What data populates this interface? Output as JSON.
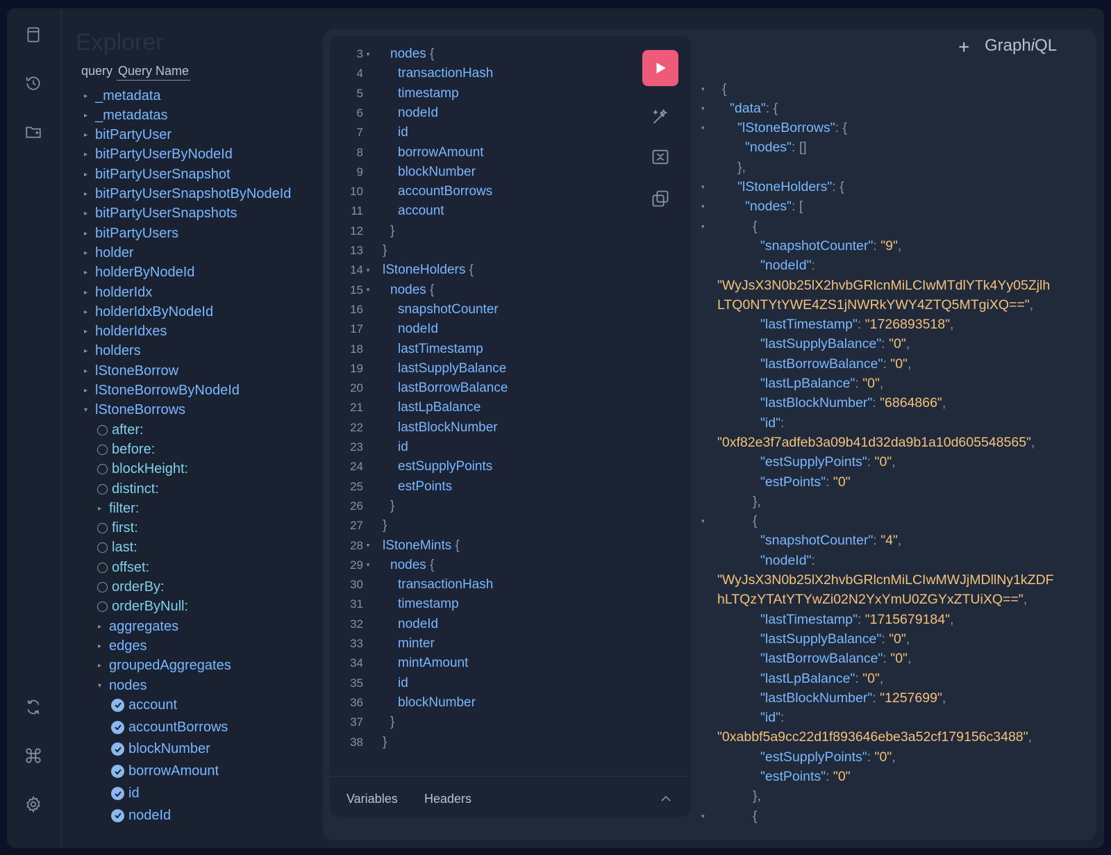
{
  "brand": {
    "text": "Graph",
    "i": "i",
    "ql": "QL"
  },
  "sidebar_icons": [
    {
      "name": "docs-icon"
    },
    {
      "name": "history-icon"
    },
    {
      "name": "explorer-icon"
    },
    {
      "name": "refetch-icon"
    },
    {
      "name": "shortcuts-icon"
    },
    {
      "name": "settings-icon"
    }
  ],
  "explorer": {
    "title": "Explorer",
    "query_keyword": "query",
    "query_name": "Query Name",
    "root_fields": [
      "_metadata",
      "_metadatas",
      "bitPartyUser",
      "bitPartyUserByNodeId",
      "bitPartyUserSnapshot",
      "bitPartyUserSnapshotByNodeId",
      "bitPartyUserSnapshots",
      "bitPartyUsers",
      "holder",
      "holderByNodeId",
      "holderIdx",
      "holderIdxByNodeId",
      "holderIdxes",
      "holders",
      "lStoneBorrow",
      "lStoneBorrowByNodeId",
      "lStoneBorrows"
    ],
    "args": [
      {
        "label": "after:",
        "type": "radio"
      },
      {
        "label": "before:",
        "type": "radio"
      },
      {
        "label": "blockHeight:",
        "type": "radio"
      },
      {
        "label": "distinct:",
        "type": "radio"
      },
      {
        "label": "filter:",
        "type": "caret"
      },
      {
        "label": "first:",
        "type": "radio"
      },
      {
        "label": "last:",
        "type": "radio"
      },
      {
        "label": "offset:",
        "type": "radio"
      },
      {
        "label": "orderBy:",
        "type": "radio"
      },
      {
        "label": "orderByNull:",
        "type": "radio"
      }
    ],
    "sub_fields": [
      "aggregates",
      "edges",
      "groupedAggregates"
    ],
    "nodes_label": "nodes",
    "checked_fields": [
      "account",
      "accountBorrows",
      "blockNumber",
      "borrowAmount",
      "id",
      "nodeId"
    ]
  },
  "editor": {
    "lines": [
      {
        "n": "3",
        "fold": true,
        "indent": 1,
        "text": "nodes",
        "brace": " {"
      },
      {
        "n": "4",
        "fold": false,
        "indent": 2,
        "text": "transactionHash",
        "brace": ""
      },
      {
        "n": "5",
        "fold": false,
        "indent": 2,
        "text": "timestamp",
        "brace": ""
      },
      {
        "n": "6",
        "fold": false,
        "indent": 2,
        "text": "nodeId",
        "brace": ""
      },
      {
        "n": "7",
        "fold": false,
        "indent": 2,
        "text": "id",
        "brace": ""
      },
      {
        "n": "8",
        "fold": false,
        "indent": 2,
        "text": "borrowAmount",
        "brace": ""
      },
      {
        "n": "9",
        "fold": false,
        "indent": 2,
        "text": "blockNumber",
        "brace": ""
      },
      {
        "n": "10",
        "fold": false,
        "indent": 2,
        "text": "accountBorrows",
        "brace": ""
      },
      {
        "n": "11",
        "fold": false,
        "indent": 2,
        "text": "account",
        "brace": ""
      },
      {
        "n": "12",
        "fold": false,
        "indent": 1,
        "text": "",
        "brace": "}"
      },
      {
        "n": "13",
        "fold": false,
        "indent": 0,
        "text": "",
        "brace": "}"
      },
      {
        "n": "14",
        "fold": true,
        "indent": 0,
        "text": "lStoneHolders",
        "brace": " {"
      },
      {
        "n": "15",
        "fold": true,
        "indent": 1,
        "text": "nodes",
        "brace": " {"
      },
      {
        "n": "16",
        "fold": false,
        "indent": 2,
        "text": "snapshotCounter",
        "brace": ""
      },
      {
        "n": "17",
        "fold": false,
        "indent": 2,
        "text": "nodeId",
        "brace": ""
      },
      {
        "n": "18",
        "fold": false,
        "indent": 2,
        "text": "lastTimestamp",
        "brace": ""
      },
      {
        "n": "19",
        "fold": false,
        "indent": 2,
        "text": "lastSupplyBalance",
        "brace": ""
      },
      {
        "n": "20",
        "fold": false,
        "indent": 2,
        "text": "lastBorrowBalance",
        "brace": ""
      },
      {
        "n": "21",
        "fold": false,
        "indent": 2,
        "text": "lastLpBalance",
        "brace": ""
      },
      {
        "n": "22",
        "fold": false,
        "indent": 2,
        "text": "lastBlockNumber",
        "brace": ""
      },
      {
        "n": "23",
        "fold": false,
        "indent": 2,
        "text": "id",
        "brace": ""
      },
      {
        "n": "24",
        "fold": false,
        "indent": 2,
        "text": "estSupplyPoints",
        "brace": ""
      },
      {
        "n": "25",
        "fold": false,
        "indent": 2,
        "text": "estPoints",
        "brace": ""
      },
      {
        "n": "26",
        "fold": false,
        "indent": 1,
        "text": "",
        "brace": "}"
      },
      {
        "n": "27",
        "fold": false,
        "indent": 0,
        "text": "",
        "brace": "}"
      },
      {
        "n": "28",
        "fold": true,
        "indent": 0,
        "text": "lStoneMints",
        "brace": " {"
      },
      {
        "n": "29",
        "fold": true,
        "indent": 1,
        "text": "nodes",
        "brace": " {"
      },
      {
        "n": "30",
        "fold": false,
        "indent": 2,
        "text": "transactionHash",
        "brace": ""
      },
      {
        "n": "31",
        "fold": false,
        "indent": 2,
        "text": "timestamp",
        "brace": ""
      },
      {
        "n": "32",
        "fold": false,
        "indent": 2,
        "text": "nodeId",
        "brace": ""
      },
      {
        "n": "33",
        "fold": false,
        "indent": 2,
        "text": "minter",
        "brace": ""
      },
      {
        "n": "34",
        "fold": false,
        "indent": 2,
        "text": "mintAmount",
        "brace": ""
      },
      {
        "n": "35",
        "fold": false,
        "indent": 2,
        "text": "id",
        "brace": ""
      },
      {
        "n": "36",
        "fold": false,
        "indent": 2,
        "text": "blockNumber",
        "brace": ""
      },
      {
        "n": "37",
        "fold": false,
        "indent": 1,
        "text": "",
        "brace": "}"
      },
      {
        "n": "38",
        "fold": false,
        "indent": 0,
        "text": "",
        "brace": "}"
      }
    ],
    "tabs": {
      "variables": "Variables",
      "headers": "Headers"
    }
  },
  "result": {
    "lines": [
      {
        "fold": true,
        "indent": 0,
        "key": "",
        "sep": "",
        "val": "",
        "tail": "{"
      },
      {
        "fold": true,
        "indent": 1,
        "key": "\"data\"",
        "sep": ": ",
        "val": "",
        "tail": "{"
      },
      {
        "fold": true,
        "indent": 2,
        "key": "\"lStoneBorrows\"",
        "sep": ": ",
        "val": "",
        "tail": "{"
      },
      {
        "fold": false,
        "indent": 3,
        "key": "\"nodes\"",
        "sep": ": ",
        "val": "",
        "tail": "[]"
      },
      {
        "fold": false,
        "indent": 2,
        "key": "",
        "sep": "",
        "val": "",
        "tail": "},"
      },
      {
        "fold": true,
        "indent": 2,
        "key": "\"lStoneHolders\"",
        "sep": ": ",
        "val": "",
        "tail": "{"
      },
      {
        "fold": true,
        "indent": 3,
        "key": "\"nodes\"",
        "sep": ": ",
        "val": "",
        "tail": "["
      },
      {
        "fold": true,
        "indent": 4,
        "key": "",
        "sep": "",
        "val": "",
        "tail": "{"
      },
      {
        "fold": false,
        "indent": 5,
        "key": "\"snapshotCounter\"",
        "sep": ": ",
        "val": "\"9\"",
        "tail": ","
      },
      {
        "fold": false,
        "indent": 5,
        "key": "\"nodeId\"",
        "sep": ":",
        "val": "",
        "tail": ""
      },
      {
        "fold": false,
        "indent": 0,
        "key": "",
        "sep": "",
        "val": "\"WyJsX3N0b25lX2hvbGRlcnMiLCIwMTdlYTk4Yy05Zjlh",
        "tail": ""
      },
      {
        "fold": false,
        "indent": 0,
        "key": "",
        "sep": "",
        "val": "LTQ0NTYtYWE4ZS1jNWRkYWY4ZTQ5MTgiXQ==\"",
        "tail": ","
      },
      {
        "fold": false,
        "indent": 5,
        "key": "\"lastTimestamp\"",
        "sep": ": ",
        "val": "\"1726893518\"",
        "tail": ","
      },
      {
        "fold": false,
        "indent": 5,
        "key": "\"lastSupplyBalance\"",
        "sep": ": ",
        "val": "\"0\"",
        "tail": ","
      },
      {
        "fold": false,
        "indent": 5,
        "key": "\"lastBorrowBalance\"",
        "sep": ": ",
        "val": "\"0\"",
        "tail": ","
      },
      {
        "fold": false,
        "indent": 5,
        "key": "\"lastLpBalance\"",
        "sep": ": ",
        "val": "\"0\"",
        "tail": ","
      },
      {
        "fold": false,
        "indent": 5,
        "key": "\"lastBlockNumber\"",
        "sep": ": ",
        "val": "\"6864866\"",
        "tail": ","
      },
      {
        "fold": false,
        "indent": 5,
        "key": "\"id\"",
        "sep": ":",
        "val": "",
        "tail": ""
      },
      {
        "fold": false,
        "indent": 0,
        "key": "",
        "sep": "",
        "val": "\"0xf82e3f7adfeb3a09b41d32da9b1a10d605548565\"",
        "tail": ","
      },
      {
        "fold": false,
        "indent": 5,
        "key": "\"estSupplyPoints\"",
        "sep": ": ",
        "val": "\"0\"",
        "tail": ","
      },
      {
        "fold": false,
        "indent": 5,
        "key": "\"estPoints\"",
        "sep": ": ",
        "val": "\"0\"",
        "tail": ""
      },
      {
        "fold": false,
        "indent": 4,
        "key": "",
        "sep": "",
        "val": "",
        "tail": "},"
      },
      {
        "fold": true,
        "indent": 4,
        "key": "",
        "sep": "",
        "val": "",
        "tail": "{"
      },
      {
        "fold": false,
        "indent": 5,
        "key": "\"snapshotCounter\"",
        "sep": ": ",
        "val": "\"4\"",
        "tail": ","
      },
      {
        "fold": false,
        "indent": 5,
        "key": "\"nodeId\"",
        "sep": ":",
        "val": "",
        "tail": ""
      },
      {
        "fold": false,
        "indent": 0,
        "key": "",
        "sep": "",
        "val": "\"WyJsX3N0b25lX2hvbGRlcnMiLCIwMWJjMDllNy1kZDF",
        "tail": ""
      },
      {
        "fold": false,
        "indent": 0,
        "key": "",
        "sep": "",
        "val": "hLTQzYTAtYTYwZi02N2YxYmU0ZGYxZTUiXQ==\"",
        "tail": ","
      },
      {
        "fold": false,
        "indent": 5,
        "key": "\"lastTimestamp\"",
        "sep": ": ",
        "val": "\"1715679184\"",
        "tail": ","
      },
      {
        "fold": false,
        "indent": 5,
        "key": "\"lastSupplyBalance\"",
        "sep": ": ",
        "val": "\"0\"",
        "tail": ","
      },
      {
        "fold": false,
        "indent": 5,
        "key": "\"lastBorrowBalance\"",
        "sep": ": ",
        "val": "\"0\"",
        "tail": ","
      },
      {
        "fold": false,
        "indent": 5,
        "key": "\"lastLpBalance\"",
        "sep": ": ",
        "val": "\"0\"",
        "tail": ","
      },
      {
        "fold": false,
        "indent": 5,
        "key": "\"lastBlockNumber\"",
        "sep": ": ",
        "val": "\"1257699\"",
        "tail": ","
      },
      {
        "fold": false,
        "indent": 5,
        "key": "\"id\"",
        "sep": ":",
        "val": "",
        "tail": ""
      },
      {
        "fold": false,
        "indent": 0,
        "key": "",
        "sep": "",
        "val": "\"0xabbf5a9cc22d1f893646ebe3a52cf179156c3488\"",
        "tail": ","
      },
      {
        "fold": false,
        "indent": 5,
        "key": "\"estSupplyPoints\"",
        "sep": ": ",
        "val": "\"0\"",
        "tail": ","
      },
      {
        "fold": false,
        "indent": 5,
        "key": "\"estPoints\"",
        "sep": ": ",
        "val": "\"0\"",
        "tail": ""
      },
      {
        "fold": false,
        "indent": 4,
        "key": "",
        "sep": "",
        "val": "",
        "tail": "},"
      },
      {
        "fold": true,
        "indent": 4,
        "key": "",
        "sep": "",
        "val": "",
        "tail": "{"
      }
    ]
  },
  "colors": {
    "accent": "#ef5a7b",
    "field": "#79b8ff",
    "string": "#f4c27a",
    "bg": "#1a2232"
  }
}
